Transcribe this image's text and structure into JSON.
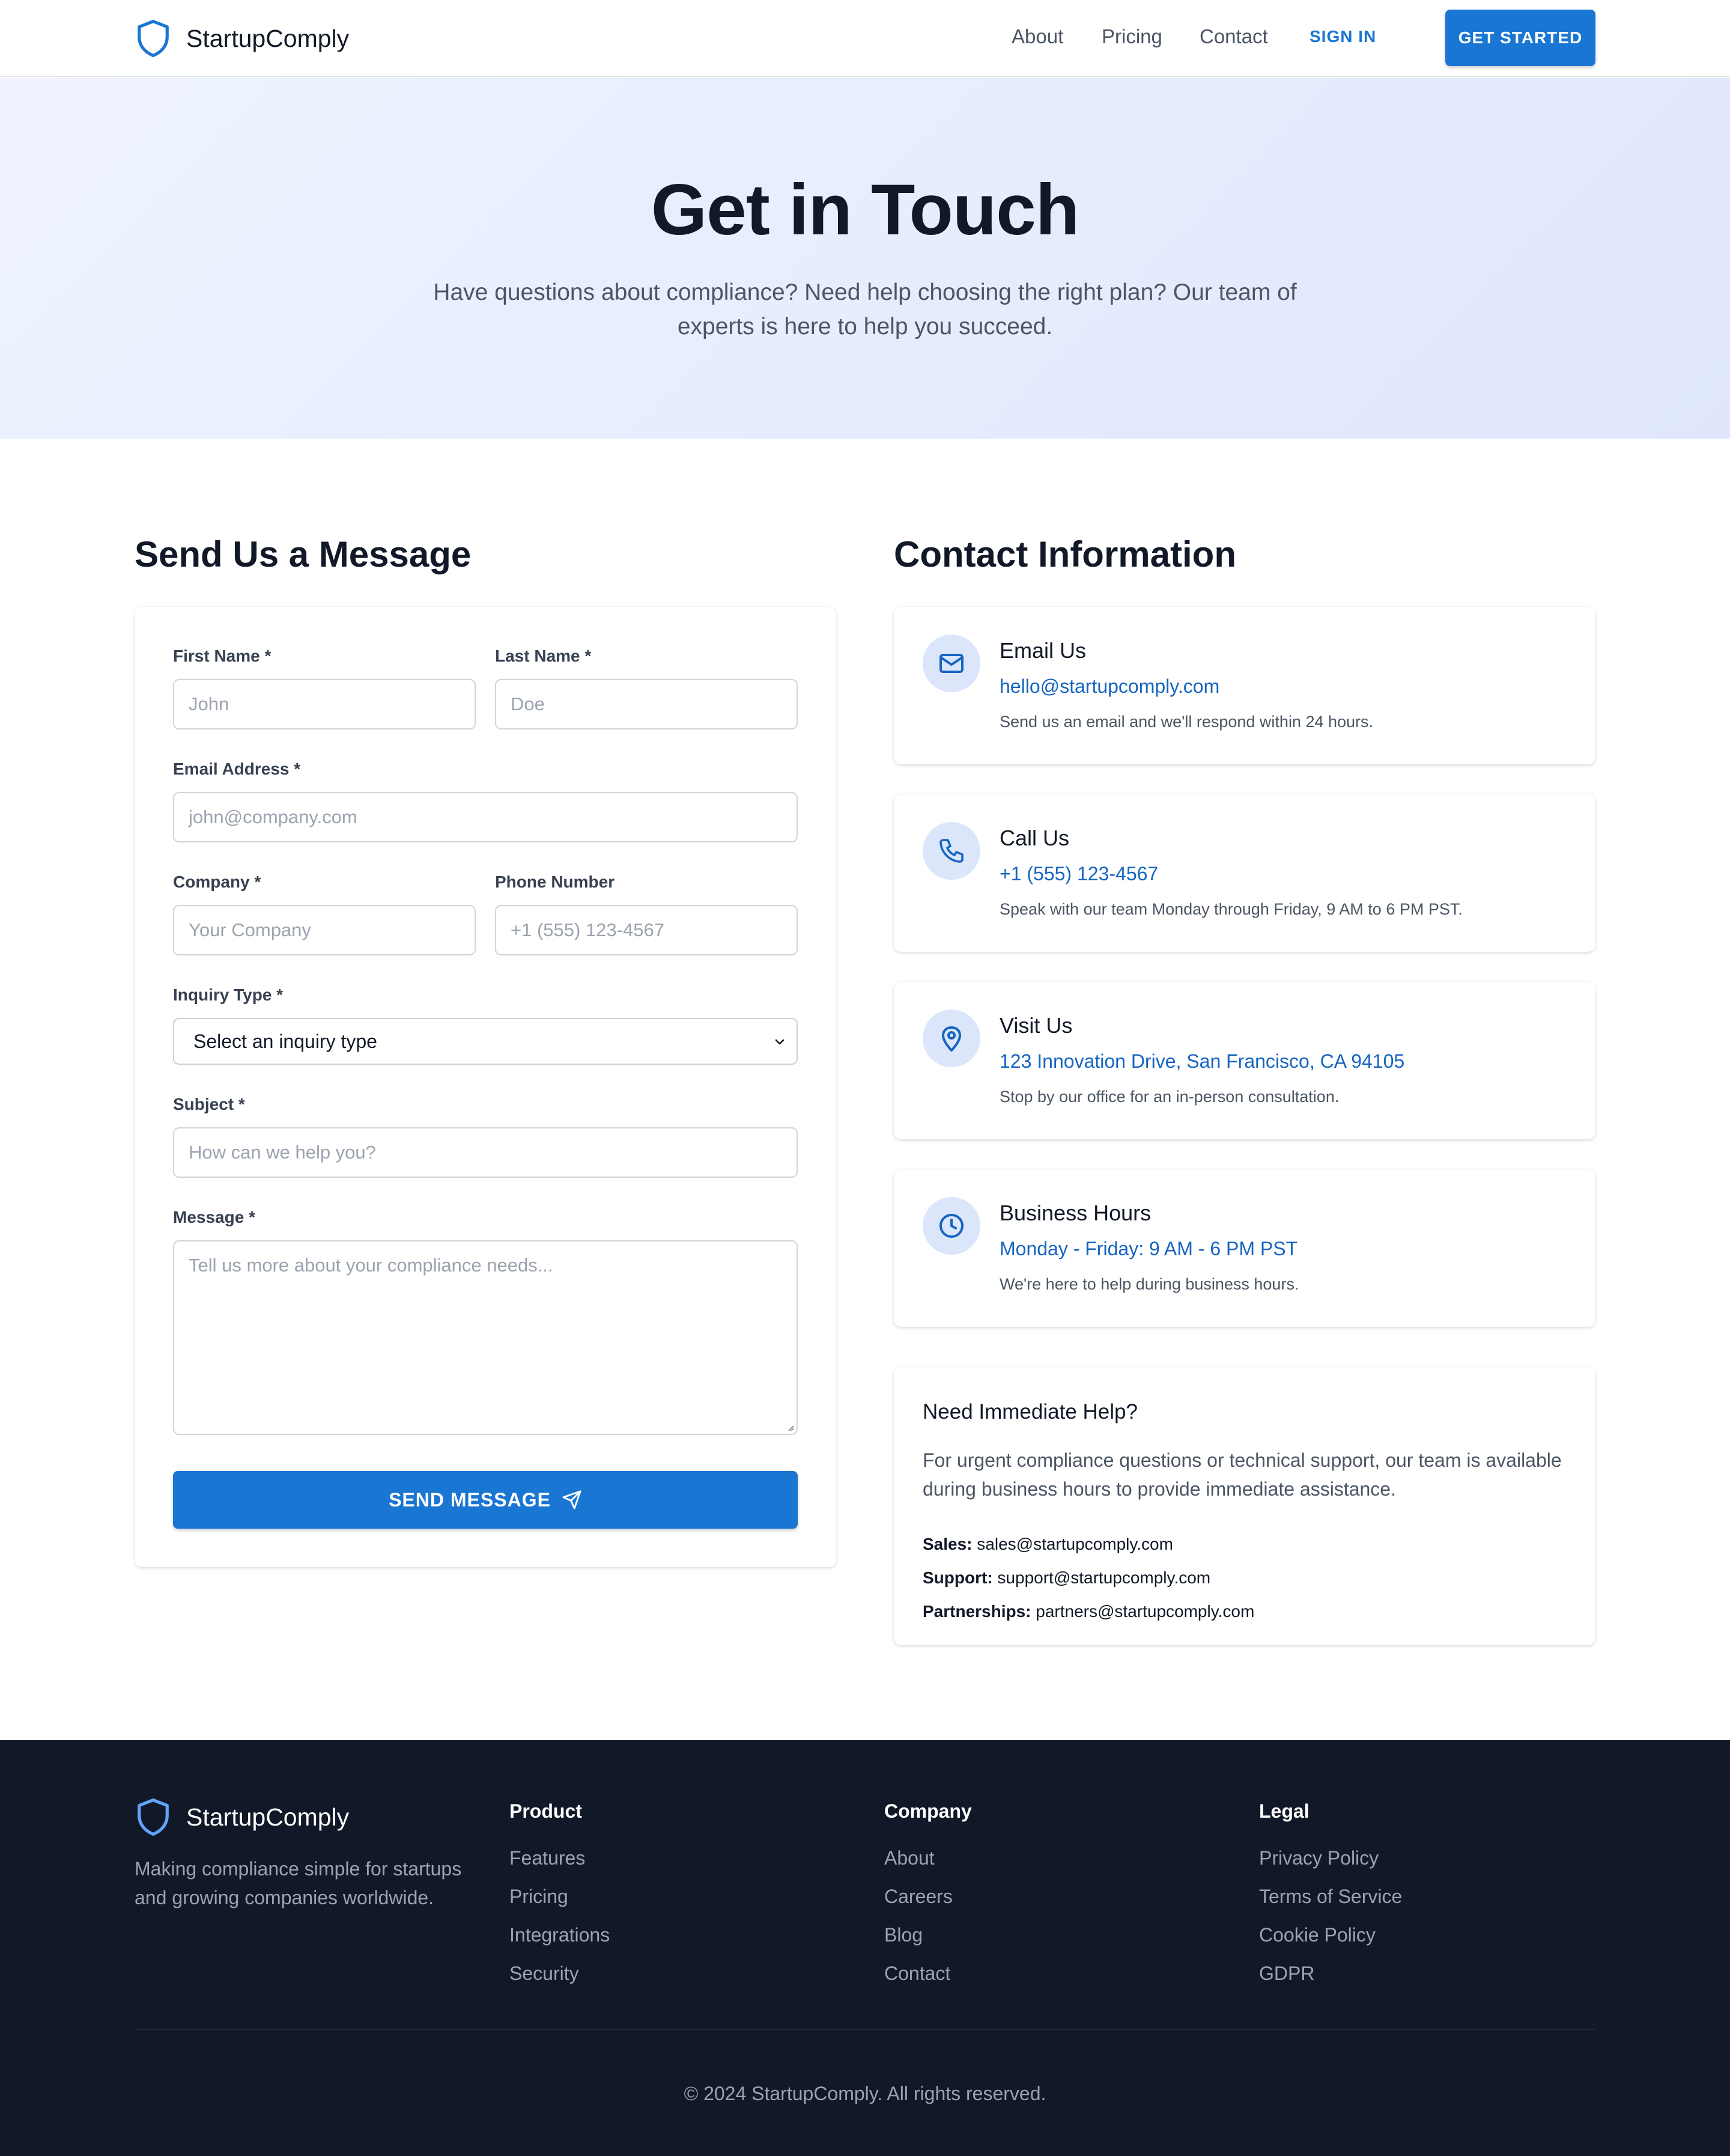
{
  "header": {
    "brand": "StartupComply",
    "nav": [
      "About",
      "Pricing",
      "Contact"
    ],
    "sign_in": "SIGN IN",
    "get_started": "GET STARTED"
  },
  "hero": {
    "title": "Get in Touch",
    "subtitle": "Have questions about compliance? Need help choosing the right plan? Our team of experts is here to help you succeed."
  },
  "form": {
    "section_title": "Send Us a Message",
    "first_name": {
      "label": "First Name *",
      "placeholder": "John"
    },
    "last_name": {
      "label": "Last Name *",
      "placeholder": "Doe"
    },
    "email": {
      "label": "Email Address *",
      "placeholder": "john@company.com"
    },
    "company": {
      "label": "Company *",
      "placeholder": "Your Company"
    },
    "phone": {
      "label": "Phone Number",
      "placeholder": "+1 (555) 123-4567"
    },
    "inquiry": {
      "label": "Inquiry Type *",
      "value": "Select an inquiry type"
    },
    "subject": {
      "label": "Subject *",
      "placeholder": "How can we help you?"
    },
    "message": {
      "label": "Message *",
      "placeholder": "Tell us more about your compliance needs..."
    },
    "submit": "SEND MESSAGE"
  },
  "contact": {
    "section_title": "Contact Information",
    "cards": [
      {
        "icon": "mail-icon",
        "title": "Email Us",
        "value": "hello@startupcomply.com",
        "desc": "Send us an email and we'll respond within 24 hours."
      },
      {
        "icon": "phone-icon",
        "title": "Call Us",
        "value": "+1 (555) 123-4567",
        "desc": "Speak with our team Monday through Friday, 9 AM to 6 PM PST."
      },
      {
        "icon": "location-pin-icon",
        "title": "Visit Us",
        "value": "123 Innovation Drive, San Francisco, CA 94105",
        "desc": "Stop by our office for an in-person consultation."
      },
      {
        "icon": "clock-icon",
        "title": "Business Hours",
        "value": "Monday - Friday: 9 AM - 6 PM PST",
        "desc": "We're here to help during business hours."
      }
    ],
    "help": {
      "title": "Need Immediate Help?",
      "text": "For urgent compliance questions or technical support, our team is available during business hours to provide immediate assistance.",
      "lines": [
        {
          "label": "Sales:",
          "value": "sales@startupcomply.com"
        },
        {
          "label": "Support:",
          "value": "support@startupcomply.com"
        },
        {
          "label": "Partnerships:",
          "value": "partners@startupcomply.com"
        }
      ]
    }
  },
  "footer": {
    "brand": "StartupComply",
    "tagline": "Making compliance simple for startups and growing companies worldwide.",
    "columns": [
      {
        "title": "Product",
        "links": [
          "Features",
          "Pricing",
          "Integrations",
          "Security"
        ]
      },
      {
        "title": "Company",
        "links": [
          "About",
          "Careers",
          "Blog",
          "Contact"
        ]
      },
      {
        "title": "Legal",
        "links": [
          "Privacy Policy",
          "Terms of Service",
          "Cookie Policy",
          "GDPR"
        ]
      }
    ],
    "copyright": "© 2024 StartupComply. All rights reserved."
  },
  "colors": {
    "primary": "#1976d2",
    "link": "#1565c0",
    "footer_bg": "#111827",
    "icon_bg": "#dbe6fb"
  }
}
